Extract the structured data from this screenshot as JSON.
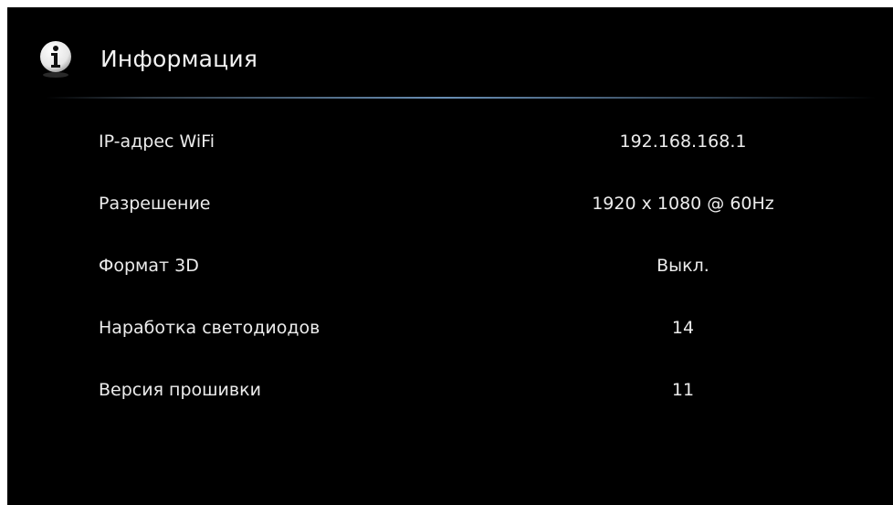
{
  "header": {
    "icon": "info-icon",
    "title": "Информация"
  },
  "info": {
    "rows": [
      {
        "label": "IP-адрес WiFi",
        "value": "192.168.168.1"
      },
      {
        "label": "Разрешение",
        "value": "1920 x 1080 @ 60Hz"
      },
      {
        "label": "Формат 3D",
        "value": "Выкл."
      },
      {
        "label": "Наработка светодиодов",
        "value": "14"
      },
      {
        "label": "Версия прошивки",
        "value": "11"
      }
    ]
  },
  "colors": {
    "background": "#000000",
    "text": "#ececec",
    "divider_accent": "#6e96be"
  }
}
